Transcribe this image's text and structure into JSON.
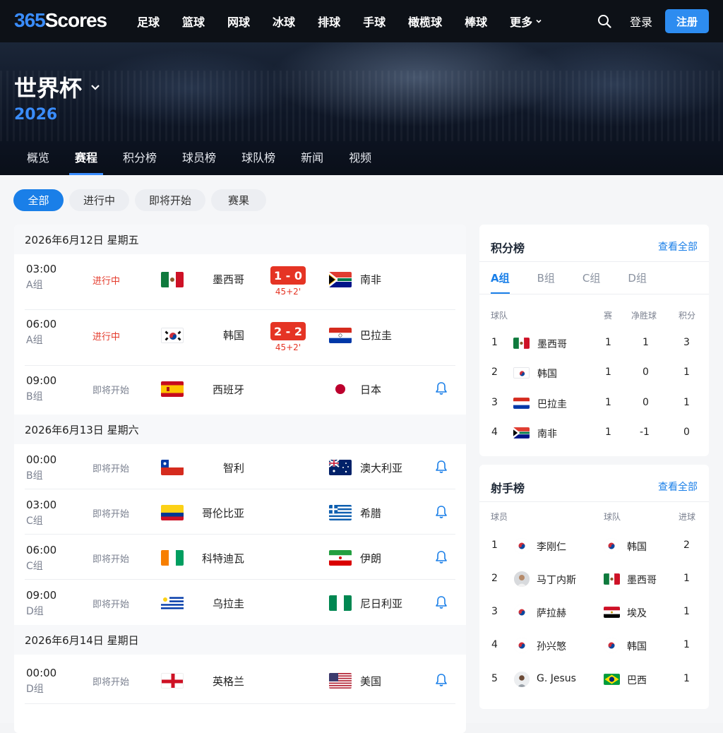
{
  "header": {
    "logo_num": "365",
    "logo_text": "Scores",
    "sports": [
      "足球",
      "篮球",
      "网球",
      "冰球",
      "排球",
      "手球",
      "橄榄球",
      "棒球"
    ],
    "more_label": "更多",
    "login_label": "登录",
    "register_label": "注册"
  },
  "competition": {
    "title": "世界杯",
    "year": "2026",
    "tabs": [
      "概览",
      "赛程",
      "积分榜",
      "球员榜",
      "球队榜",
      "新闻",
      "视频"
    ],
    "active_tab": "赛程"
  },
  "filters": [
    "全部",
    "进行中",
    "即将开始",
    "赛果"
  ],
  "active_filter": "全部",
  "matches": {
    "days": [
      {
        "date": "2026年6月12日 星期五",
        "matches": [
          {
            "time": "03:00",
            "group": "A组",
            "status": "进行中",
            "home": "墨西哥",
            "away": "南非",
            "score": "1 - 0",
            "minute": "45+2'"
          },
          {
            "time": "06:00",
            "group": "A组",
            "status": "进行中",
            "home": "韩国",
            "away": "巴拉圭",
            "score": "2 - 2",
            "minute": "45+2'"
          },
          {
            "time": "09:00",
            "group": "B组",
            "status": "即将开始",
            "home": "西班牙",
            "away": "日本"
          }
        ]
      },
      {
        "date": "2026年6月13日 星期六",
        "matches": [
          {
            "time": "00:00",
            "group": "B组",
            "status": "即将开始",
            "home": "智利",
            "away": "澳大利亚"
          },
          {
            "time": "03:00",
            "group": "C组",
            "status": "即将开始",
            "home": "哥伦比亚",
            "away": "希腊"
          },
          {
            "time": "06:00",
            "group": "C组",
            "status": "即将开始",
            "home": "科特迪瓦",
            "away": "伊朗"
          },
          {
            "time": "09:00",
            "group": "D组",
            "status": "即将开始",
            "home": "乌拉圭",
            "away": "尼日利亚"
          }
        ]
      },
      {
        "date": "2026年6月14日 星期日",
        "matches": [
          {
            "time": "00:00",
            "group": "D组",
            "status": "即将开始",
            "home": "英格兰",
            "away": "美国"
          }
        ]
      }
    ]
  },
  "standings": {
    "title": "积分榜",
    "see_all": "查看全部",
    "groups": [
      "A组",
      "B组",
      "C组",
      "D组"
    ],
    "active_group": "A组",
    "columns": [
      "球队",
      "赛",
      "净胜球",
      "积分"
    ],
    "rows": [
      {
        "rank": "1",
        "team": "墨西哥",
        "played": "1",
        "gd": "1",
        "pts": "3"
      },
      {
        "rank": "2",
        "team": "韩国",
        "played": "1",
        "gd": "0",
        "pts": "1"
      },
      {
        "rank": "3",
        "team": "巴拉圭",
        "played": "1",
        "gd": "0",
        "pts": "1"
      },
      {
        "rank": "4",
        "team": "南非",
        "played": "1",
        "gd": "-1",
        "pts": "0"
      }
    ]
  },
  "scorers": {
    "title": "射手榜",
    "see_all": "查看全部",
    "columns": [
      "球员",
      "球队",
      "进球"
    ],
    "rows": [
      {
        "rank": "1",
        "player": "李刚仁",
        "team": "韩国",
        "goals": "2"
      },
      {
        "rank": "2",
        "player": "马丁内斯",
        "team": "墨西哥",
        "goals": "1"
      },
      {
        "rank": "3",
        "player": "萨拉赫",
        "team": "埃及",
        "goals": "1"
      },
      {
        "rank": "4",
        "player": "孙兴慜",
        "team": "韩国",
        "goals": "1"
      },
      {
        "rank": "5",
        "player": "G. Jesus",
        "team": "巴西",
        "goals": "1"
      }
    ]
  },
  "colors": {
    "accent": "#1a7fe8",
    "live_red": "#e53424",
    "topbar": "#0d1117"
  }
}
